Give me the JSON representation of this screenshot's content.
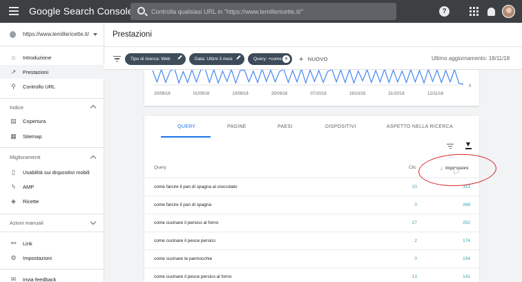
{
  "topbar": {
    "brand": "Google Search Console",
    "search_placeholder": "Controlla qualsiasi URL in \"https://www.lemillericette.it/\"",
    "help_icon_glyph": "?"
  },
  "sidebar": {
    "property_url": "https://www.lemillericette.it/",
    "items_top": [
      {
        "icon": "home-icon",
        "glyph": "⌂",
        "label": "Introduzione"
      },
      {
        "icon": "trending-icon",
        "glyph": "↗",
        "label": "Prestazioni"
      },
      {
        "icon": "search-icon",
        "glyph": "⚲",
        "label": "Controllo URL"
      }
    ],
    "section_index": "Indice",
    "items_index": [
      {
        "icon": "coverage-icon",
        "glyph": "▤",
        "label": "Copertura"
      },
      {
        "icon": "sitemap-icon",
        "glyph": "▦",
        "label": "Sitemap"
      }
    ],
    "section_improvements": "Miglioramenti",
    "items_improvements": [
      {
        "icon": "mobile-icon",
        "glyph": "▯",
        "label": "Usabilità sui dispositivi mobili"
      },
      {
        "icon": "amp-icon",
        "glyph": "ϟ",
        "label": "AMP"
      },
      {
        "icon": "recipes-icon",
        "glyph": "◈",
        "label": "Ricette"
      }
    ],
    "section_manual": "Azioni manuali",
    "items_bottom": [
      {
        "icon": "link-icon",
        "glyph": "⚯",
        "label": "Link"
      },
      {
        "icon": "settings-icon",
        "glyph": "⚙",
        "label": "Impostazioni"
      },
      {
        "icon": "feedback-icon",
        "glyph": "✉",
        "label": "Invia feedback"
      }
    ]
  },
  "header": {
    "title": "Prestazioni"
  },
  "filters": {
    "chips": [
      {
        "label": "Tipo di ricerca: Web",
        "kind": "edit"
      },
      {
        "label": "Data: Ultimi 3 mesi",
        "kind": "edit"
      },
      {
        "label": "Query: +come",
        "kind": "remove"
      }
    ],
    "new_label": "NUOVO",
    "last_update": "Ultimo aggiornamento: 18/11/18"
  },
  "chart_data": {
    "type": "line",
    "title": "",
    "xlabel": "",
    "ylabel": "",
    "x_tick_labels": [
      "20/08/18",
      "01/09/18",
      "13/09/18",
      "25/09/18",
      "07/10/18",
      "19/10/18",
      "31/10/18",
      "12/11/18"
    ],
    "right_axis_label": "0",
    "series": [
      {
        "color": "#4285f4",
        "values": [
          2.8,
          0.6,
          3.0,
          0.5,
          2.7,
          3.2,
          0.4,
          2.6,
          0.5,
          2.9,
          0.6,
          2.9,
          3.1,
          0.5,
          3.0,
          0.4,
          2.7,
          0.7,
          3.0,
          0.4,
          2.8,
          2.9,
          0.6,
          2.7,
          0.5,
          3.1,
          0.7,
          2.9,
          0.6,
          2.6,
          3.0,
          0.5,
          2.8,
          0.6,
          3.1,
          0.4,
          2.9,
          0.7,
          2.8,
          0.5,
          2.6,
          3.0,
          0.6,
          2.9,
          0.5,
          3.0,
          0.4,
          2.7,
          0.8,
          3.0,
          0.5,
          2.8,
          0.6,
          3.1,
          0.5,
          2.9,
          0.6,
          2.7,
          0.5,
          3.0,
          0.6,
          2.8,
          0.4,
          3.0,
          0.7,
          2.9,
          0.5,
          2.8,
          0.6,
          3.0,
          0.3,
          0.2
        ]
      }
    ],
    "ylim": [
      0,
      4
    ],
    "grid": false
  },
  "table": {
    "tabs": [
      "QUERY",
      "PAGINE",
      "PAESI",
      "DISPOSITIVI",
      "ASPETTO NELLA RICERCA"
    ],
    "active_tab": 0,
    "columns": {
      "query": "Query",
      "clicks": "Clic",
      "impressions": "Impressioni"
    },
    "sort_arrow": "↓",
    "rows": [
      {
        "query": "come farcire il pan di spagna al cioccolato",
        "clicks": "20",
        "impressions": "313"
      },
      {
        "query": "come farcire il pan di spagna",
        "clicks": "0",
        "impressions": "268"
      },
      {
        "query": "come cucinare il persico al forno",
        "clicks": "27",
        "impressions": "252"
      },
      {
        "query": "come cucinare il pesce persico",
        "clicks": "2",
        "impressions": "174"
      },
      {
        "query": "come cucinare le pannocchie",
        "clicks": "0",
        "impressions": "154"
      },
      {
        "query": "come cucinare il pesce persico al forno",
        "clicks": "13",
        "impressions": "141"
      }
    ]
  },
  "colors": {
    "topbar": "#3c4043",
    "accent": "#1a73e8",
    "chip": "#3c4b59",
    "line": "#4285f4",
    "highlight": "#d7202a"
  }
}
